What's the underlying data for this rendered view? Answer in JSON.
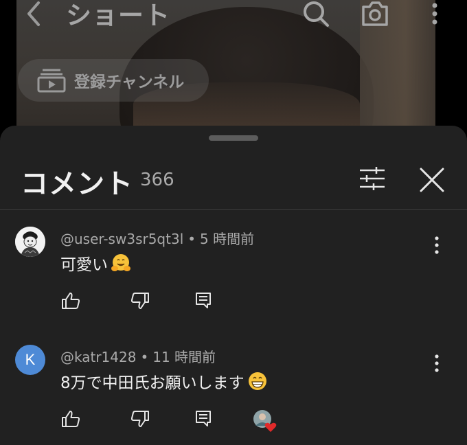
{
  "header": {
    "title": "ショート",
    "back_icon": "chevron-left-icon",
    "search_icon": "search-icon",
    "camera_icon": "camera-icon",
    "more_icon": "more-vert-icon",
    "subscribe_chip_label": "登録チャンネル",
    "subscribe_chip_icon": "subscriptions-icon"
  },
  "comments_sheet": {
    "title": "コメント",
    "count": "366",
    "filter_icon": "tune-icon",
    "close_icon": "close-icon",
    "comments": [
      {
        "user": "@user-sw3sr5qt3l",
        "separator": "•",
        "time": "5 時間前",
        "text": "可愛い",
        "emoji": "hugging-face",
        "avatar_letter": ""
      },
      {
        "user": "@katr1428",
        "separator": "•",
        "time": "11 時間前",
        "text": "8万で中田氏お願いします",
        "emoji": "grinning-face",
        "avatar_letter": "K",
        "avatar_color": "#4e8ad6",
        "creator_heart": true
      }
    ]
  },
  "colors": {
    "sheet_bg": "#212121",
    "text_primary": "#f1f1f1",
    "text_secondary": "#aaaaaa",
    "heart": "#e02a2a"
  }
}
